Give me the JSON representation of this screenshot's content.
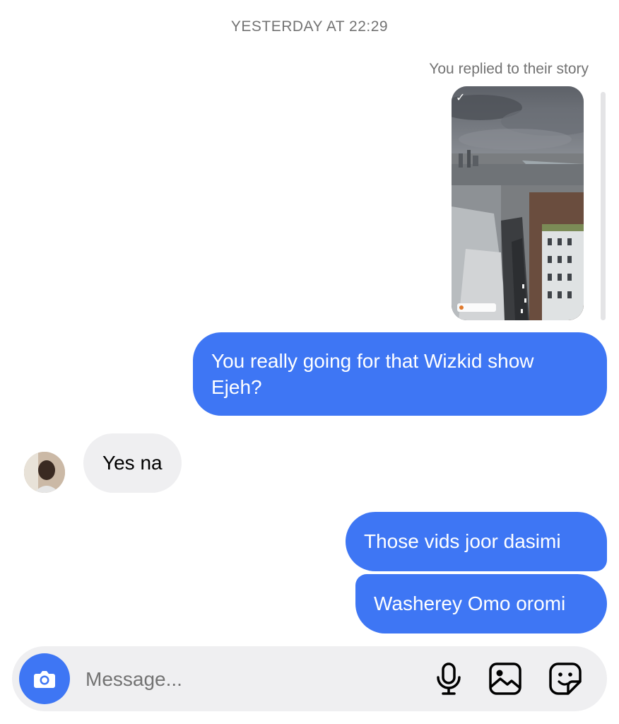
{
  "thread": {
    "timestamp": "YESTERDAY AT 22:29",
    "story_reply_caption": "You replied to their story"
  },
  "messages": [
    {
      "direction": "outgoing",
      "text": "You really going for that Wizkid show Ejeh?"
    },
    {
      "direction": "incoming",
      "text": "Yes na"
    },
    {
      "direction": "outgoing",
      "text": "Those vids joor dasimi"
    },
    {
      "direction": "outgoing",
      "text": "Washerey Omo oromi"
    }
  ],
  "composer": {
    "placeholder": "Message...",
    "camera_icon": "camera-icon",
    "mic_icon": "microphone-icon",
    "gallery_icon": "image-gallery-icon",
    "sticker_icon": "sticker-icon"
  },
  "colors": {
    "outgoing_bubble": "#3e76f4",
    "incoming_bubble": "#efeff1",
    "meta_text": "#737373"
  }
}
